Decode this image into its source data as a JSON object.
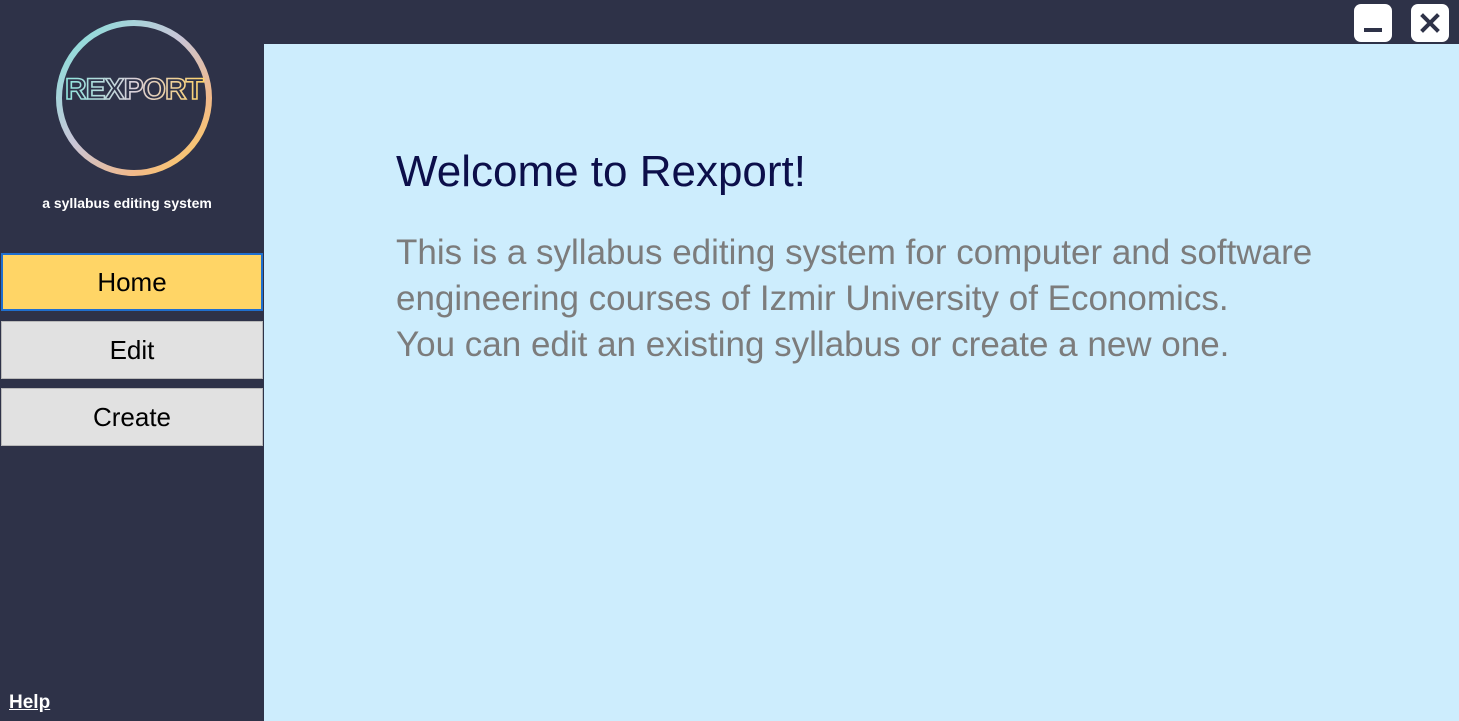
{
  "app": {
    "logo_text": "REXPORT",
    "tagline": "a syllabus editing system"
  },
  "sidebar": {
    "items": [
      {
        "label": "Home",
        "active": true
      },
      {
        "label": "Edit",
        "active": false
      },
      {
        "label": "Create",
        "active": false
      }
    ],
    "help_label": "Help"
  },
  "main": {
    "title": "Welcome to Rexport!",
    "body_lines": [
      "This is a syllabus editing system for computer and software",
      "engineering courses of Izmir University of Economics.",
      "You can edit an existing syllabus or create a new one."
    ]
  },
  "window_controls": {
    "minimize_icon": "minimize-icon",
    "close_icon": "close-icon"
  },
  "colors": {
    "sidebar_bg": "#2e3248",
    "main_bg": "#cdedfd",
    "active_button": "#ffd566",
    "active_border": "#1f6fcf",
    "inactive_button": "#e1e1e1",
    "title_color": "#0c0f4a",
    "body_color": "#7c7c7c"
  }
}
